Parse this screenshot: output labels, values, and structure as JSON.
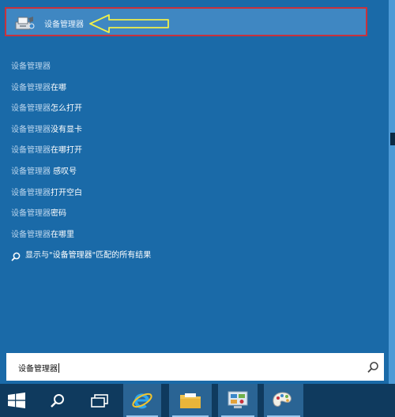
{
  "search_panel": {
    "top_result": {
      "icon": "device-manager-icon",
      "label": "设备管理器"
    },
    "suggestions": [
      {
        "highlight": "设备管理器",
        "rest": ""
      },
      {
        "highlight": "设备管理器",
        "rest": "在哪"
      },
      {
        "highlight": "设备管理器",
        "rest": "怎么打开"
      },
      {
        "highlight": "设备管理器",
        "rest": "没有显卡"
      },
      {
        "highlight": "设备管理器",
        "rest": "在哪打开"
      },
      {
        "highlight": "设备管理器",
        "rest": " 感叹号"
      },
      {
        "highlight": "设备管理器",
        "rest": "打开空白"
      },
      {
        "highlight": "设备管理器",
        "rest": "密码"
      },
      {
        "highlight": "设备管理器",
        "rest": "在哪里"
      }
    ],
    "show_all_results": "显示与\"设备管理器\"匹配的所有结果"
  },
  "search_box": {
    "value": "设备管理器",
    "icon": "search-icon"
  },
  "taskbar": {
    "items": [
      "start-icon",
      "search-icon",
      "task-view-icon",
      "internet-explorer-icon",
      "file-explorer-icon",
      "control-panel-icon",
      "paint-icon"
    ]
  },
  "colors": {
    "panel": "#1a6aa8",
    "highlight_border": "#c8323c",
    "arrow": "#f1f04a",
    "taskbar": "#0f3a5e"
  }
}
